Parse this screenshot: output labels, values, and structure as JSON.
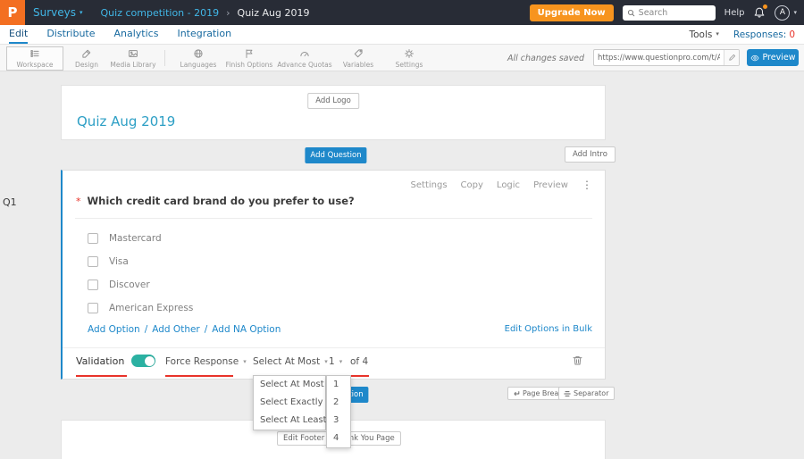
{
  "topbar": {
    "logo_letter": "P",
    "product_menu": "Surveys",
    "breadcrumb": [
      "Quiz competition - 2019",
      "Quiz Aug 2019"
    ],
    "upgrade_button": "Upgrade Now",
    "search_placeholder": "Search",
    "help_link": "Help",
    "avatar_letter": "A"
  },
  "nav": {
    "tabs": [
      "Edit",
      "Distribute",
      "Analytics",
      "Integration"
    ],
    "active_tab": "Edit",
    "tools_menu": "Tools",
    "responses_label": "Responses:",
    "responses_count": "0"
  },
  "toolbar": {
    "items": [
      "Workspace",
      "Design",
      "Media Library",
      "Languages",
      "Finish Options",
      "Advance Quotas",
      "Variables",
      "Settings"
    ],
    "active_item": "Workspace",
    "save_status": "All changes saved",
    "survey_url": "https://www.questionpro.com/t/APNrFZ",
    "preview_button": "Preview"
  },
  "survey": {
    "question_label": "Q1",
    "add_logo_button": "Add Logo",
    "title": "Quiz Aug 2019",
    "add_question_button": "Add Question",
    "add_intro_button": "Add Intro"
  },
  "question": {
    "actions": [
      "Settings",
      "Copy",
      "Logic",
      "Preview"
    ],
    "required_marker": "*",
    "text": "Which credit card brand do you prefer to use?",
    "options": [
      "Mastercard",
      "Visa",
      "Discover",
      "American Express"
    ],
    "option_links": [
      "Add Option",
      "Add Other",
      "Add NA Option"
    ],
    "link_separator": "/",
    "bulk_edit_link": "Edit Options in Bulk",
    "validation": {
      "label": "Validation",
      "toggle_on": true,
      "force_response": "Force Response",
      "rule": "Select At Most",
      "count": "1",
      "of_total": "of 4"
    }
  },
  "dropdowns": {
    "rules": [
      "Select At Most",
      "Select Exactly",
      "Select At Least"
    ],
    "numbers": [
      "1",
      "2",
      "3",
      "4"
    ]
  },
  "footer": {
    "add_question_button": "Add Question",
    "page_break_button": "Page Break",
    "separator_button": "Separator",
    "edit_footer_button": "Edit Footer",
    "thank_you_button": "Thank You Page"
  },
  "icons": {
    "caret_down": "▾",
    "breadcrumb_chevron": "›",
    "overflow_menu": "⋮"
  },
  "colors": {
    "accent_blue": "#1e88ca",
    "brand_orange": "#f36f21",
    "upgrade_orange": "#f7941e",
    "toggle_teal": "#2bb1a2",
    "annotation_red": "#e8332a",
    "title_teal": "#2d9fc5"
  }
}
